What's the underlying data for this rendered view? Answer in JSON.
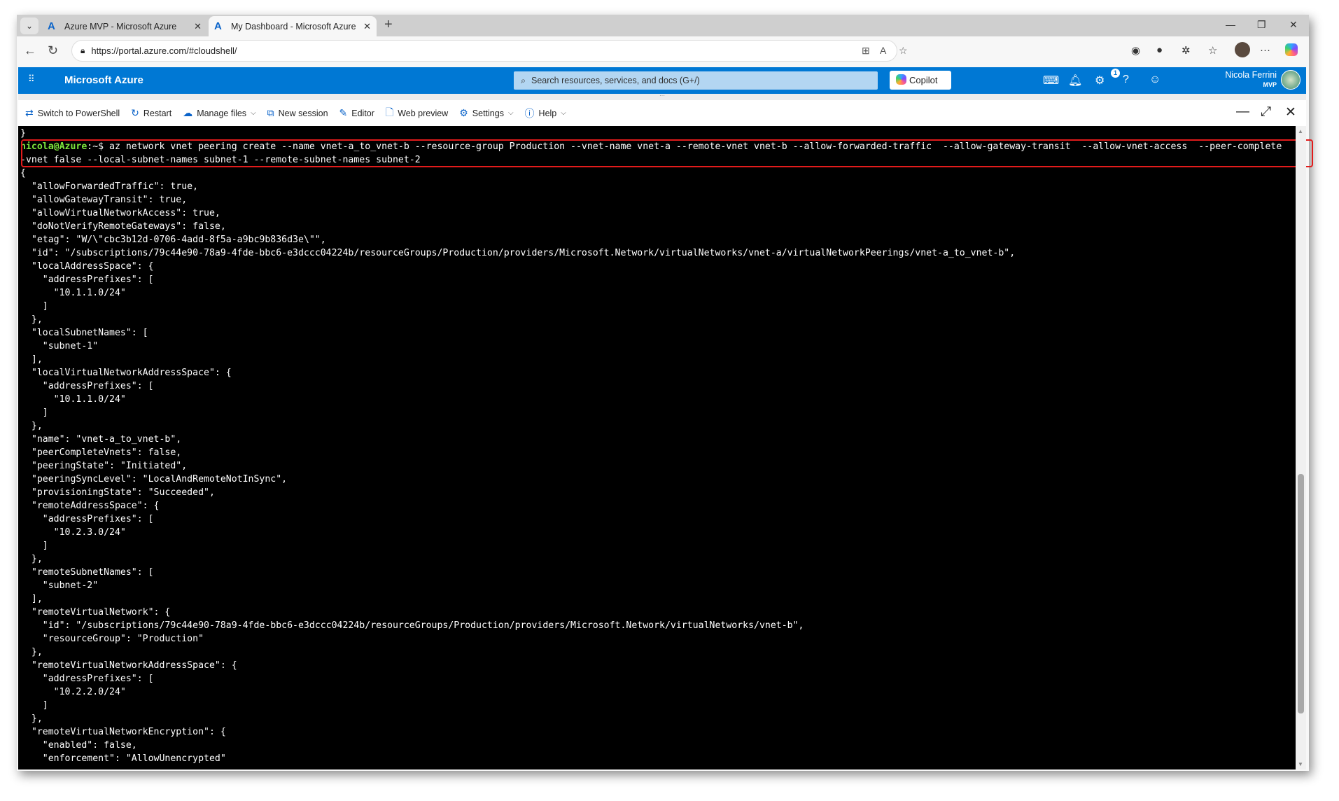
{
  "browser": {
    "tabs": [
      {
        "title": "Azure MVP - Microsoft Azure",
        "active": false
      },
      {
        "title": "My Dashboard - Microsoft Azure",
        "active": true
      }
    ],
    "url": "https://portal.azure.com/#cloudshell/"
  },
  "portal": {
    "brand": "Microsoft Azure",
    "search_placeholder": "Search resources, services, and docs (G+/)",
    "copilot_label": "Copilot",
    "notification_count": "1",
    "user_name": "Nicola Ferrini",
    "user_badge": "MVP"
  },
  "cloudshell": {
    "toolbar": {
      "switch": "Switch to PowerShell",
      "restart": "Restart",
      "manage_files": "Manage files",
      "new_session": "New session",
      "editor": "Editor",
      "web_preview": "Web preview",
      "settings": "Settings",
      "help": "Help"
    },
    "prompt_user": "nicola@Azure",
    "prompt_rest": ":~$ az network vnet peering create --name vnet-a_to_vnet-b --resource-group Production --vnet-name vnet-a --remote-vnet vnet-b --allow-forwarded-traffic  --allow-gateway-transit  --allow-vnet-access  --peer-complete",
    "before": "}",
    "command_wrap": "-vnet false --local-subnet-names subnet-1 --remote-subnet-names subnet-2",
    "output": [
      "{",
      "  \"allowForwardedTraffic\": true,",
      "  \"allowGatewayTransit\": true,",
      "  \"allowVirtualNetworkAccess\": true,",
      "  \"doNotVerifyRemoteGateways\": false,",
      "  \"etag\": \"W/\\\"cbc3b12d-0706-4add-8f5a-a9bc9b836d3e\\\"\",",
      "  \"id\": \"/subscriptions/79c44e90-78a9-4fde-bbc6-e3dccc04224b/resourceGroups/Production/providers/Microsoft.Network/virtualNetworks/vnet-a/virtualNetworkPeerings/vnet-a_to_vnet-b\",",
      "  \"localAddressSpace\": {",
      "    \"addressPrefixes\": [",
      "      \"10.1.1.0/24\"",
      "    ]",
      "  },",
      "  \"localSubnetNames\": [",
      "    \"subnet-1\"",
      "  ],",
      "  \"localVirtualNetworkAddressSpace\": {",
      "    \"addressPrefixes\": [",
      "      \"10.1.1.0/24\"",
      "    ]",
      "  },",
      "  \"name\": \"vnet-a_to_vnet-b\",",
      "  \"peerCompleteVnets\": false,",
      "  \"peeringState\": \"Initiated\",",
      "  \"peeringSyncLevel\": \"LocalAndRemoteNotInSync\",",
      "  \"provisioningState\": \"Succeeded\",",
      "  \"remoteAddressSpace\": {",
      "    \"addressPrefixes\": [",
      "      \"10.2.3.0/24\"",
      "    ]",
      "  },",
      "  \"remoteSubnetNames\": [",
      "    \"subnet-2\"",
      "  ],",
      "  \"remoteVirtualNetwork\": {",
      "    \"id\": \"/subscriptions/79c44e90-78a9-4fde-bbc6-e3dccc04224b/resourceGroups/Production/providers/Microsoft.Network/virtualNetworks/vnet-b\",",
      "    \"resourceGroup\": \"Production\"",
      "  },",
      "  \"remoteVirtualNetworkAddressSpace\": {",
      "    \"addressPrefixes\": [",
      "      \"10.2.2.0/24\"",
      "    ]",
      "  },",
      "  \"remoteVirtualNetworkEncryption\": {",
      "    \"enabled\": false,",
      "    \"enforcement\": \"AllowUnencrypted\""
    ],
    "scroll_position": 0.72
  },
  "colors": {
    "azure_blue": "#0078d4",
    "prompt_green": "#7ee63d",
    "highlight_red": "#e21b1b"
  }
}
